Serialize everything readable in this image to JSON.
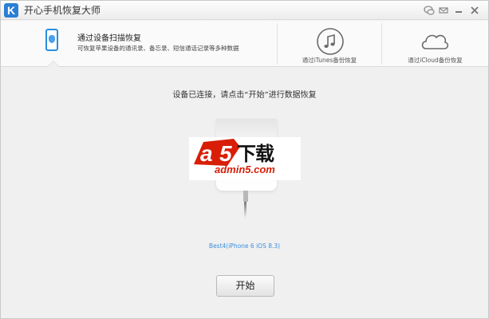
{
  "window": {
    "title": "开心手机恢复大师",
    "logo_letter": "K"
  },
  "titlebar_controls": [
    "chat-icon",
    "feedback-icon",
    "minimize-icon",
    "close-icon"
  ],
  "tabs": [
    {
      "title": "通过设备扫描恢复",
      "desc": "可恢复苹果设备的通讯录、备忘录、短信通话记录等多种数据",
      "icon": "iphone-icon",
      "active": true
    },
    {
      "label": "通过iTunes备份恢复",
      "icon": "music-note-icon",
      "active": false
    },
    {
      "label": "通过iCloud备份恢复",
      "icon": "cloud-icon",
      "active": false
    }
  ],
  "main": {
    "instruction": "设备已连接，请点击“开始”进行数据恢复",
    "device_name": "Best4(iPhone 6 iOS 8.3)",
    "start_label": "开始"
  },
  "watermark": {
    "brand_a": "a",
    "brand_5": "5",
    "brand_text": "下载",
    "site": "admin5.com"
  },
  "colors": {
    "accent": "#2a8ee0",
    "watermark_red": "#d81e06"
  }
}
